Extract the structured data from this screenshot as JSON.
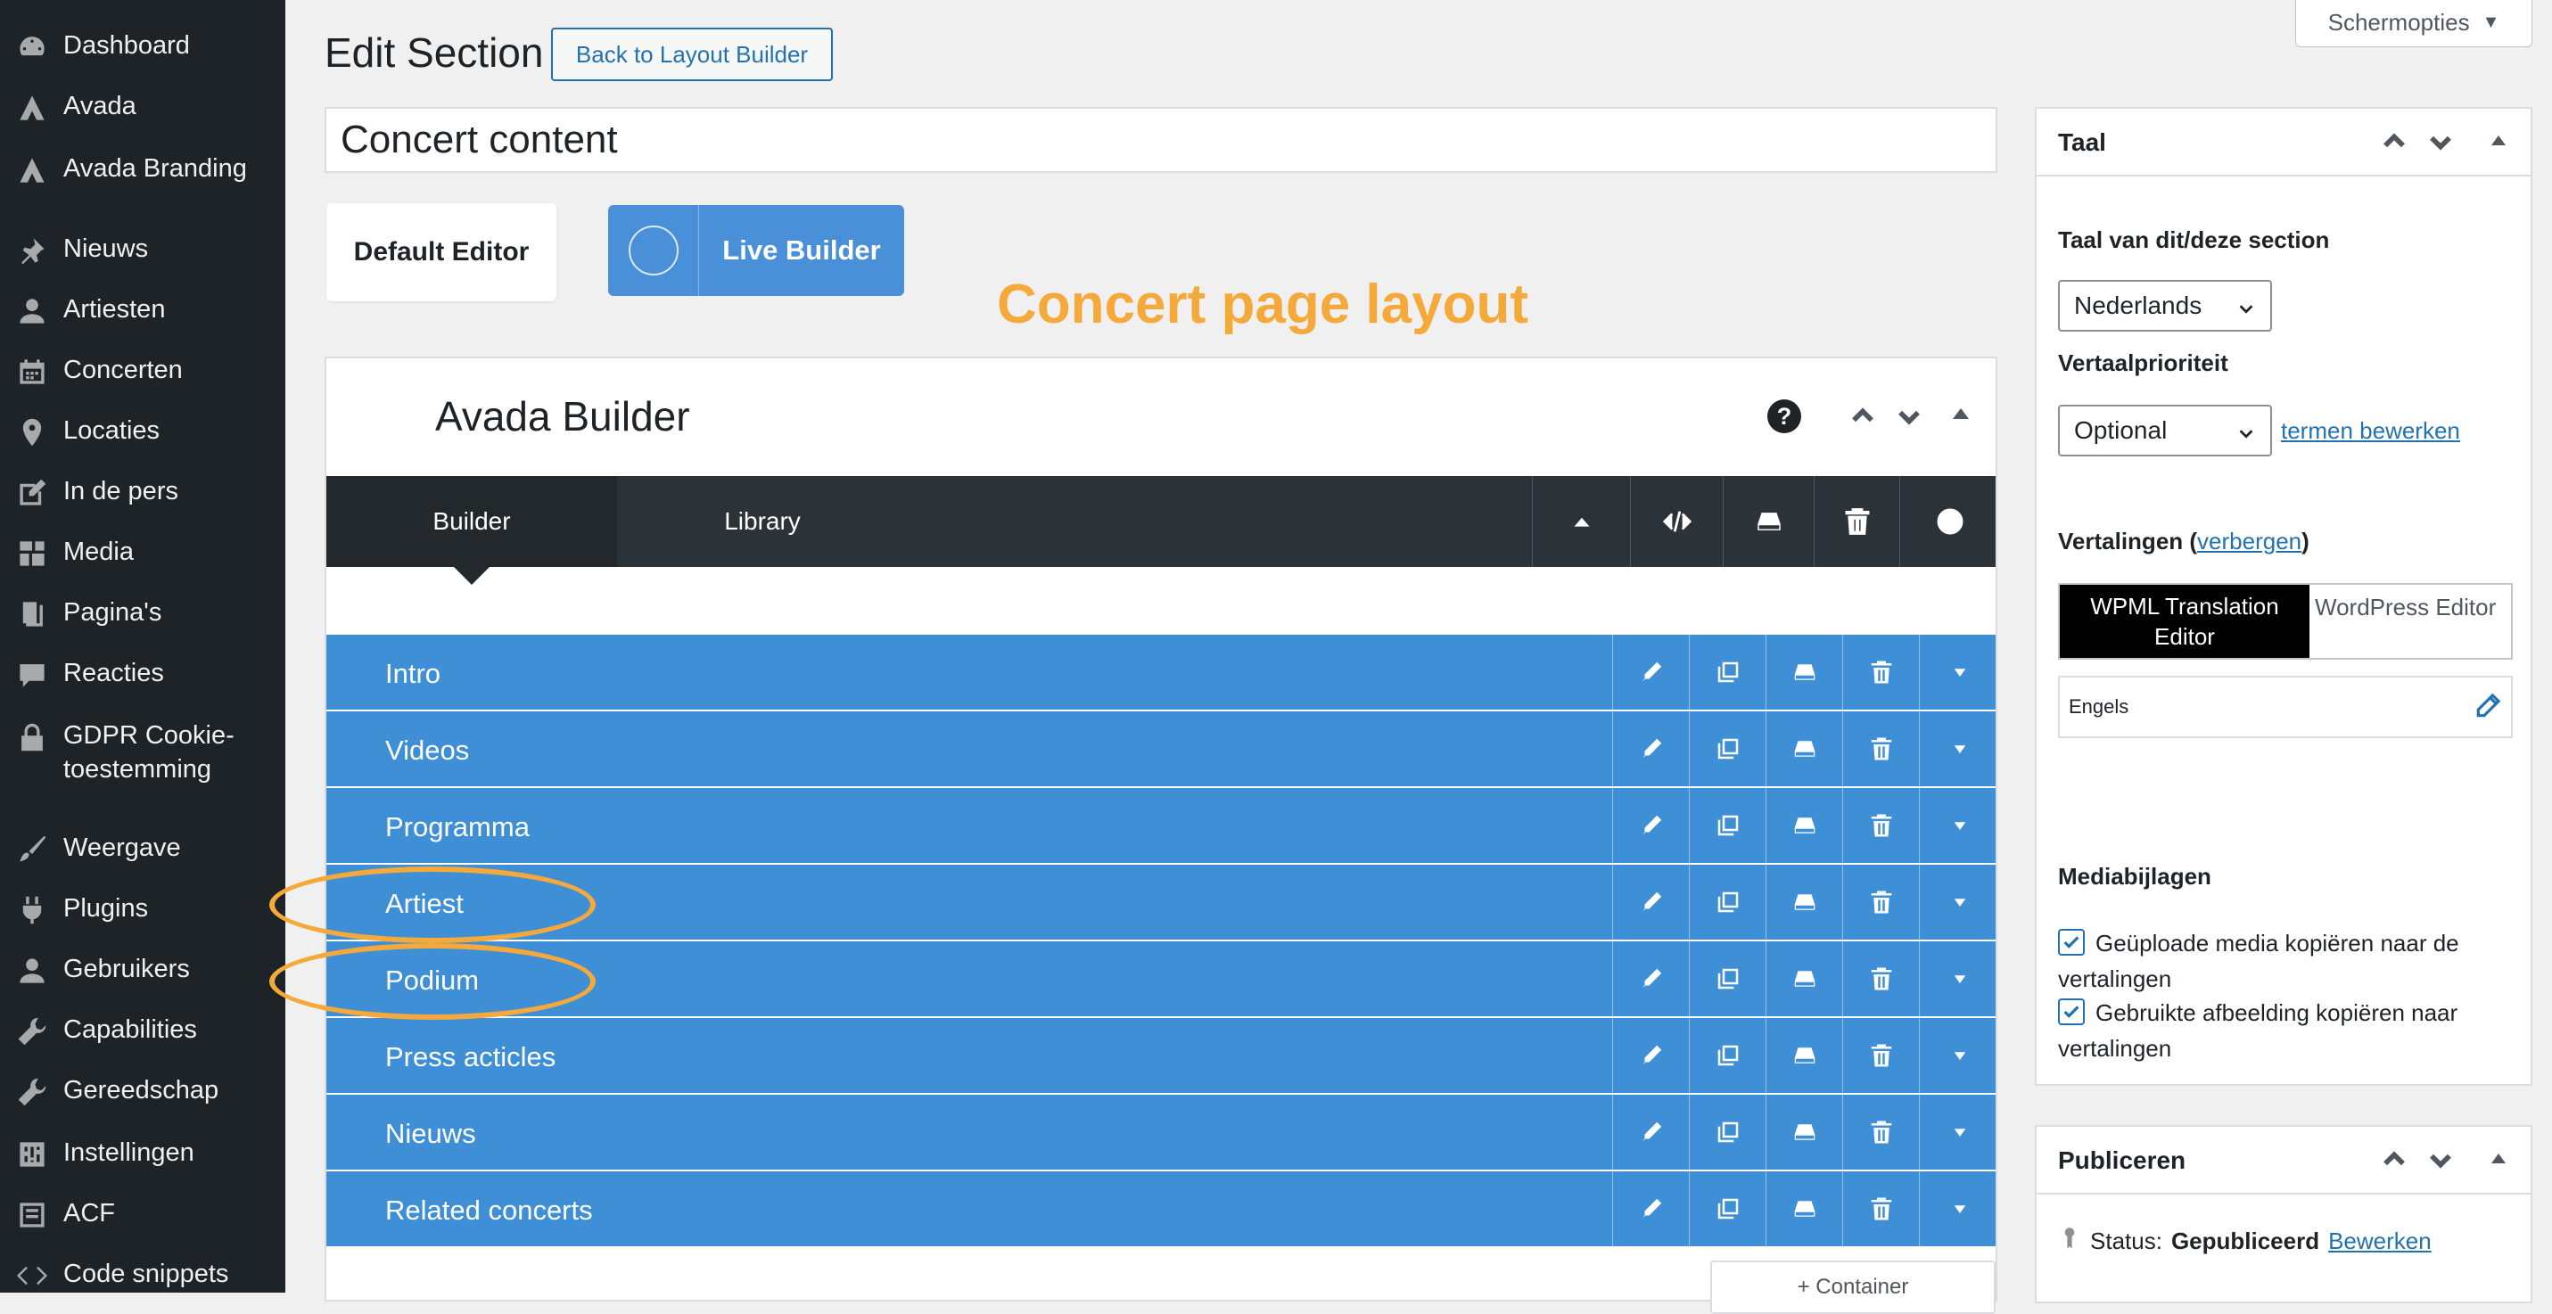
{
  "sidebar": {
    "items": [
      {
        "label": "Dashboard",
        "icon": "dashboard-icon"
      },
      {
        "label": "Avada",
        "icon": "avada-icon"
      },
      {
        "label": "Avada Branding",
        "icon": "avada-icon"
      },
      {
        "label": "Nieuws",
        "icon": "pin-icon"
      },
      {
        "label": "Artiesten",
        "icon": "user-icon"
      },
      {
        "label": "Concerten",
        "icon": "calendar-icon"
      },
      {
        "label": "Locaties",
        "icon": "location-icon"
      },
      {
        "label": "In de pers",
        "icon": "edit-icon"
      },
      {
        "label": "Media",
        "icon": "media-icon"
      },
      {
        "label": "Pagina's",
        "icon": "page-icon"
      },
      {
        "label": "Reacties",
        "icon": "comment-icon"
      },
      {
        "label": "GDPR Cookie-",
        "label2": "toestemming",
        "icon": "lock-icon"
      },
      {
        "label": "Weergave",
        "icon": "brush-icon"
      },
      {
        "label": "Plugins",
        "icon": "plugin-icon"
      },
      {
        "label": "Gebruikers",
        "icon": "user-icon"
      },
      {
        "label": "Capabilities",
        "icon": "wrench-icon"
      },
      {
        "label": "Gereedschap",
        "icon": "wrench-icon"
      },
      {
        "label": "Instellingen",
        "icon": "settings-icon"
      },
      {
        "label": "ACF",
        "icon": "acf-icon"
      },
      {
        "label": "Code snippets",
        "icon": "code-icon"
      }
    ]
  },
  "header": {
    "screen_options": "Schermopties",
    "page_title": "Edit Section",
    "back_button": "Back to Layout Builder",
    "title_value": "Concert content"
  },
  "editors": {
    "default_editor": "Default Editor",
    "live_builder": "Live Builder"
  },
  "annotation": {
    "title": "Concert page layout",
    "color": "#f5a93a"
  },
  "builder": {
    "title": "Avada Builder",
    "help": "?",
    "tabs": [
      "Builder",
      "Library"
    ],
    "rows": [
      "Intro",
      "Videos",
      "Programma",
      "Artiest",
      "Podium",
      "Press acticles",
      "Nieuws",
      "Related concerts"
    ],
    "add_container": "+ Container",
    "row_color": "#3f8fd7"
  },
  "taal_panel": {
    "title": "Taal",
    "section_label": "Taal van dit/deze section",
    "language_value": "Nederlands",
    "priority_label": "Vertaalprioriteit",
    "priority_value": "Optional",
    "edit_terms_link": "termen bewerken",
    "translations_label": "Vertalingen (",
    "translations_hide_link": "verbergen",
    "translations_close": ")",
    "tab_active": "WPML Translation Editor",
    "tab_inactive": "WordPress Editor",
    "language_row": "Engels",
    "media_label": "Mediabijlagen",
    "checkbox1": "Geüploade media kopiëren naar de vertalingen",
    "checkbox2": "Gebruikte afbeelding kopiëren naar vertalingen"
  },
  "publish_panel": {
    "title": "Publiceren",
    "status_label": "Status:",
    "status_value": "Gepubliceerd",
    "edit_link": "Bewerken"
  }
}
